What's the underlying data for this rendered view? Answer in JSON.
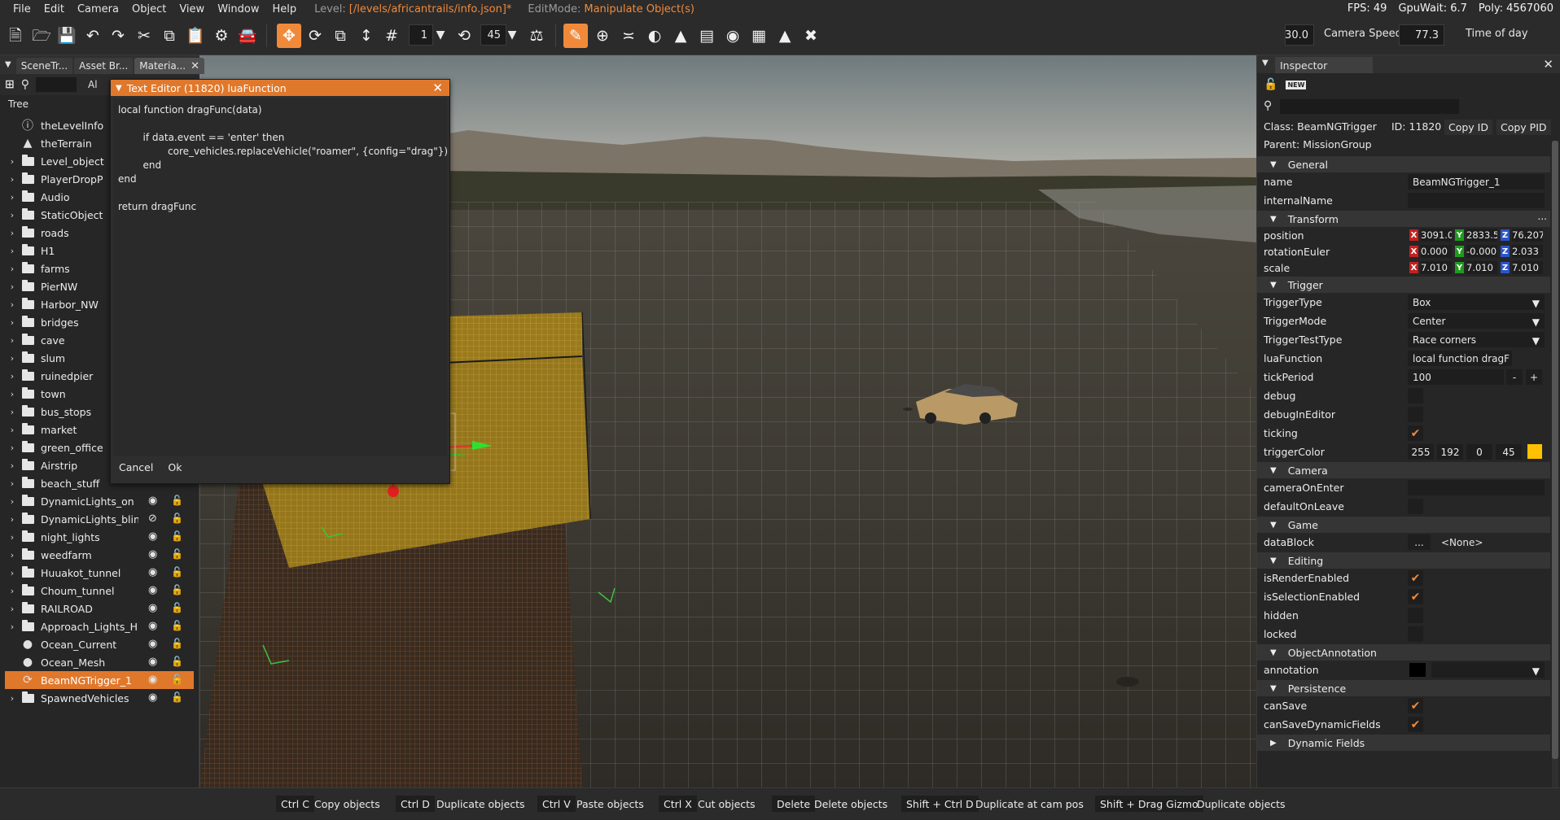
{
  "menubar": {
    "items": [
      "File",
      "Edit",
      "Camera",
      "Object",
      "View",
      "Window",
      "Help"
    ],
    "level_label": "Level:",
    "level_value": "[/levels/africantrails/info.json]*",
    "editmode_label": "EditMode:",
    "editmode_value": "Manipulate Object(s)",
    "fps": "FPS: 49",
    "gpuwait": "GpuWait: 6.7",
    "poly": "Poly: 4567060"
  },
  "toolbar": {
    "snap_value": "1",
    "rotate_snap_value": "45",
    "camera_speed_value": "30.0",
    "camera_speed_label": "Camera Speed",
    "time_of_day_value": "77.3",
    "time_of_day_label": "Time of day",
    "icons": [
      "new-file",
      "open-folder",
      "save",
      "undo",
      "redo",
      "cut",
      "copy",
      "paste",
      "settings",
      "vehicle",
      "translate",
      "rotate",
      "scale",
      "snap-move",
      "grid",
      "rotate-snap",
      "align",
      "edit-pencil",
      "add",
      "road",
      "terrain",
      "forest",
      "layers",
      "decals",
      "texture",
      "road-spline",
      "random"
    ]
  },
  "left_panel": {
    "tabs": [
      "SceneTr...",
      "Asset Br...",
      "Materia..."
    ],
    "filter_label": "Al",
    "tree_header": "Tree",
    "tree": [
      {
        "label": "theLevelInfo",
        "icon": "info",
        "arrow": false,
        "vis": false
      },
      {
        "label": "theTerrain",
        "icon": "terrain",
        "arrow": false,
        "vis": false
      },
      {
        "label": "Level_object",
        "icon": "folder",
        "arrow": true,
        "vis": false
      },
      {
        "label": "PlayerDropP",
        "icon": "folder",
        "arrow": true,
        "vis": false
      },
      {
        "label": "Audio",
        "icon": "folder",
        "arrow": true,
        "vis": false
      },
      {
        "label": "StaticObject",
        "icon": "folder",
        "arrow": true,
        "vis": false
      },
      {
        "label": "roads",
        "icon": "folder",
        "arrow": true,
        "vis": false
      },
      {
        "label": "H1",
        "icon": "folder",
        "arrow": true,
        "vis": false
      },
      {
        "label": "farms",
        "icon": "folder",
        "arrow": true,
        "vis": false
      },
      {
        "label": "PierNW",
        "icon": "folder",
        "arrow": true,
        "vis": false
      },
      {
        "label": "Harbor_NW",
        "icon": "folder",
        "arrow": true,
        "vis": false
      },
      {
        "label": "bridges",
        "icon": "folder",
        "arrow": true,
        "vis": false
      },
      {
        "label": "cave",
        "icon": "folder",
        "arrow": true,
        "vis": false
      },
      {
        "label": "slum",
        "icon": "folder",
        "arrow": true,
        "vis": false
      },
      {
        "label": "ruinedpier",
        "icon": "folder",
        "arrow": true,
        "vis": false
      },
      {
        "label": "town",
        "icon": "folder",
        "arrow": true,
        "vis": false
      },
      {
        "label": "bus_stops",
        "icon": "folder",
        "arrow": true,
        "vis": false
      },
      {
        "label": "market",
        "icon": "folder",
        "arrow": true,
        "vis": false
      },
      {
        "label": "green_office",
        "icon": "folder",
        "arrow": true,
        "vis": false
      },
      {
        "label": "Airstrip",
        "icon": "folder",
        "arrow": true,
        "vis": false
      },
      {
        "label": "beach_stuff",
        "icon": "folder",
        "arrow": true,
        "vis": false
      },
      {
        "label": "DynamicLights_on",
        "icon": "folder",
        "arrow": true,
        "vis": true,
        "eye": "eye"
      },
      {
        "label": "DynamicLights_blinl",
        "icon": "folder",
        "arrow": true,
        "vis": true,
        "eye": "eye-off"
      },
      {
        "label": "night_lights",
        "icon": "folder",
        "arrow": true,
        "vis": true,
        "eye": "eye"
      },
      {
        "label": "weedfarm",
        "icon": "folder",
        "arrow": true,
        "vis": true,
        "eye": "eye"
      },
      {
        "label": "Huuakot_tunnel",
        "icon": "folder",
        "arrow": true,
        "vis": true,
        "eye": "eye"
      },
      {
        "label": "Choum_tunnel",
        "icon": "folder",
        "arrow": true,
        "vis": true,
        "eye": "eye"
      },
      {
        "label": "RAILROAD",
        "icon": "folder",
        "arrow": true,
        "vis": true,
        "eye": "eye"
      },
      {
        "label": "Approach_Lights_HI",
        "icon": "folder",
        "arrow": true,
        "vis": true,
        "eye": "eye"
      },
      {
        "label": "Ocean_Current",
        "icon": "circle",
        "arrow": false,
        "vis": true,
        "eye": "eye"
      },
      {
        "label": "Ocean_Mesh",
        "icon": "circle",
        "arrow": false,
        "vis": true,
        "eye": "eye"
      },
      {
        "label": "BeamNGTrigger_1",
        "icon": "trigger",
        "arrow": false,
        "vis": true,
        "eye": "eye",
        "selected": true
      },
      {
        "label": "SpawnedVehicles",
        "icon": "folder",
        "arrow": true,
        "vis": true,
        "eye": "eye"
      }
    ]
  },
  "text_editor": {
    "title": "Text Editor (11820) luaFunction",
    "code": "local function dragFunc(data)\n\n        if data.event == 'enter' then\n                core_vehicles.replaceVehicle(\"roamer\", {config=\"drag\"})\n        end\nend\n\nreturn dragFunc",
    "cancel_label": "Cancel",
    "ok_label": "Ok"
  },
  "inspector": {
    "tab_label": "Inspector",
    "new_label": "NEW",
    "class_text": "Class:  BeamNGTrigger",
    "id_text": "ID:  11820",
    "copy_id": "Copy ID",
    "copy_pid": "Copy PID",
    "parent_text": "Parent:  MissionGroup",
    "sections": {
      "general": "General",
      "transform": "Transform",
      "trigger": "Trigger",
      "camera": "Camera",
      "game": "Game",
      "editing": "Editing",
      "objectannotation": "ObjectAnnotation",
      "persistence": "Persistence",
      "dynamic": "Dynamic Fields",
      "more": "..."
    },
    "props": {
      "name_label": "name",
      "name_value": "BeamNGTrigger_1",
      "internal_label": "internalName",
      "position_label": "position",
      "rotation_label": "rotationEuler",
      "scale_label": "scale",
      "position": {
        "x": "3091.0",
        "y": "2833.5",
        "z": "76.207"
      },
      "rotation": {
        "x": "0.000",
        "y": "-0.000",
        "z": "2.033"
      },
      "scale": {
        "x": "7.010",
        "y": "7.010",
        "z": "7.010"
      },
      "triggertype_label": "TriggerType",
      "triggertype_value": "Box",
      "triggermode_label": "TriggerMode",
      "triggermode_value": "Center",
      "triggertest_label": "TriggerTestType",
      "triggertest_value": "Race corners",
      "lua_label": "luaFunction",
      "lua_value": "local function dragF",
      "tick_label": "tickPeriod",
      "tick_value": "100",
      "debug_label": "debug",
      "debugineditor_label": "debugInEditor",
      "ticking_label": "ticking",
      "color_label": "triggerColor",
      "color": {
        "r": "255",
        "g": "192",
        "b": "0",
        "a": "45",
        "swatch": "#ffc000"
      },
      "cameraonenter_label": "cameraOnEnter",
      "defaultonleave_label": "defaultOnLeave",
      "datablock_label": "dataBlock",
      "datablock_button": "...",
      "datablock_value": "<None>",
      "isrender_label": "isRenderEnabled",
      "isselection_label": "isSelectionEnabled",
      "hidden_label": "hidden",
      "locked_label": "locked",
      "annotation_label": "annotation",
      "cansave_label": "canSave",
      "cansavedyn_label": "canSaveDynamicFields",
      "minus": "-",
      "plus": "+"
    }
  },
  "statusbar": [
    {
      "key": "Ctrl C",
      "desc": "Copy objects"
    },
    {
      "key": "Ctrl D",
      "desc": "Duplicate objects"
    },
    {
      "key": "Ctrl V",
      "desc": "Paste objects"
    },
    {
      "key": "Ctrl X",
      "desc": "Cut objects"
    },
    {
      "key": "Delete",
      "desc": "Delete objects"
    },
    {
      "key": "Shift + Ctrl D",
      "desc": "Duplicate at cam pos"
    },
    {
      "key": "Shift + Drag Gizmo",
      "desc": "Duplicate objects"
    }
  ],
  "colors": {
    "accent": "#e0782c",
    "trigger": "#ffc000"
  }
}
